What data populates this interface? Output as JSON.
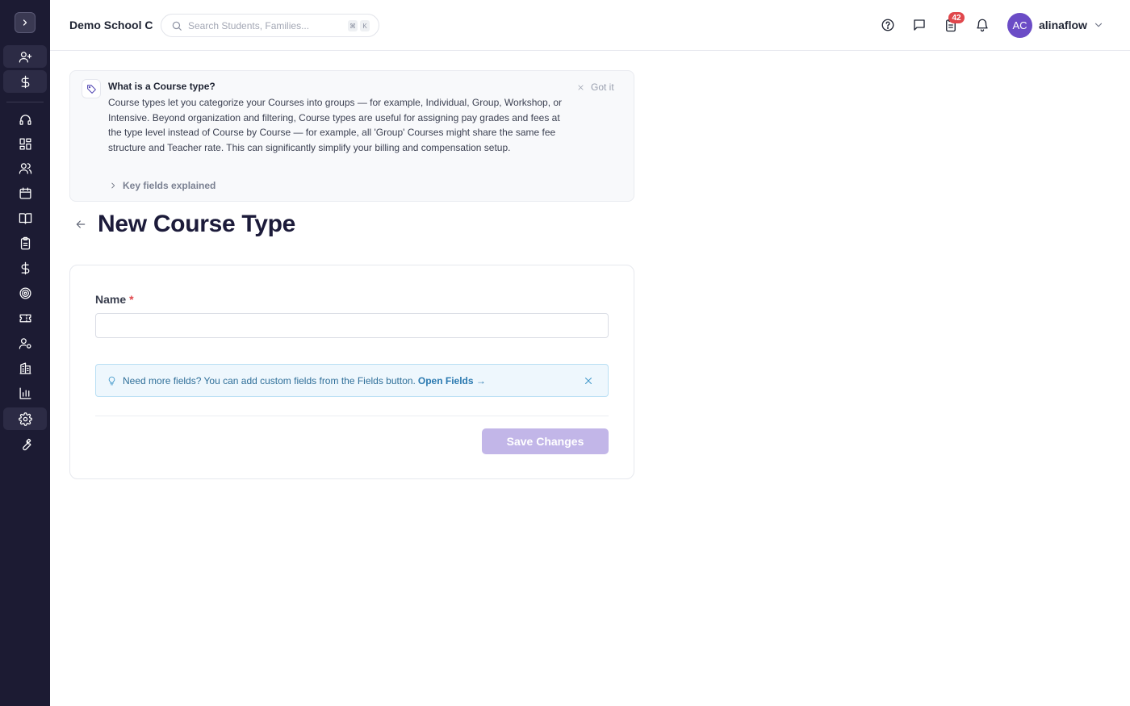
{
  "sidebar": {
    "toggle_icon": "chevron-right-icon",
    "items": [
      {
        "name": "add-user",
        "icon": "user-plus-icon"
      },
      {
        "name": "billing",
        "icon": "dollar-icon"
      },
      {
        "name": "support",
        "icon": "headset-icon"
      },
      {
        "name": "dashboard",
        "icon": "grid-icon"
      },
      {
        "name": "people",
        "icon": "users-icon"
      },
      {
        "name": "calendar",
        "icon": "calendar-icon"
      },
      {
        "name": "courses",
        "icon": "book-icon"
      },
      {
        "name": "attendance",
        "icon": "clipboard-icon"
      },
      {
        "name": "payments",
        "icon": "dollar-icon"
      },
      {
        "name": "goals",
        "icon": "target-icon"
      },
      {
        "name": "tickets",
        "icon": "ticket-icon"
      },
      {
        "name": "user-settings",
        "icon": "user-gear-icon"
      },
      {
        "name": "buildings",
        "icon": "building-icon"
      },
      {
        "name": "reports",
        "icon": "bar-chart-icon"
      },
      {
        "name": "settings",
        "icon": "gear-icon",
        "active": true
      },
      {
        "name": "tools",
        "icon": "wrench-icon"
      }
    ]
  },
  "header": {
    "school_name": "Demo School C",
    "search": {
      "placeholder": "Search Students, Families...",
      "value": "",
      "shortcut_keys": [
        "⌘",
        "K"
      ]
    },
    "tasks_badge": "42",
    "user": {
      "initials": "AC",
      "name": "alinaflow"
    }
  },
  "info_banner": {
    "title": "What is a Course type?",
    "body": "Course types let you categorize your Courses into groups — for example, Individual, Group, Workshop, or Intensive. Beyond organization and filtering, Course types are useful for assigning pay grades and fees at the type level instead of Course by Course — for example, all 'Group' Courses might share the same fee structure and Teacher rate. This can significantly simplify your billing and compensation setup.",
    "dismiss_label": "Got it",
    "key_fields_label": "Key fields explained"
  },
  "page": {
    "title": "New Course Type"
  },
  "form": {
    "name_label": "Name",
    "required_mark": "*",
    "name_value": "",
    "tip_text": "Need more fields? You can add custom fields from the Fields button.",
    "tip_link": "Open Fields →",
    "save_label": "Save Changes"
  },
  "colors": {
    "sidebar_bg": "#1c1b33",
    "accent": "#6b4cc6",
    "save_disabled": "#c2b6e8",
    "badge": "#e0474c",
    "tip_bg": "#eef7fd"
  }
}
